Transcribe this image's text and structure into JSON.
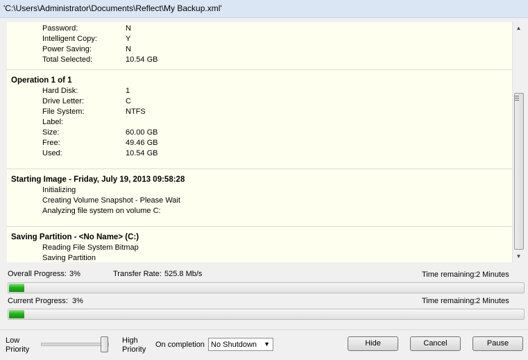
{
  "window": {
    "title": "'C:\\Users\\Administrator\\Documents\\Reflect\\My Backup.xml'"
  },
  "log": {
    "summary_tail": [
      {
        "key": "Password:",
        "value": "N"
      },
      {
        "key": "Intelligent Copy:",
        "value": "Y"
      },
      {
        "key": "Power Saving:",
        "value": "N"
      },
      {
        "key": "Total Selected:",
        "value": "10.54 GB"
      }
    ],
    "operation": {
      "title": "Operation 1 of 1",
      "rows": [
        {
          "key": "Hard Disk:",
          "value": "1"
        },
        {
          "key": "Drive Letter:",
          "value": "C"
        },
        {
          "key": "File System:",
          "value": "NTFS"
        },
        {
          "key": "Label:",
          "value": ""
        },
        {
          "key": "Size:",
          "value": "60.00 GB"
        },
        {
          "key": "Free:",
          "value": "49.46 GB"
        },
        {
          "key": "Used:",
          "value": "10.54 GB"
        }
      ]
    },
    "starting_image": {
      "title": "Starting Image - Friday, July 19, 2013 09:58:28",
      "lines": [
        "Initializing",
        "Creating Volume Snapshot - Please Wait",
        "Analyzing file system on volume C:"
      ]
    },
    "saving_partition": {
      "title": "Saving Partition - <No Name> (C:)",
      "lines": [
        "Reading File System Bitmap",
        "Saving Partition"
      ]
    }
  },
  "scrollbar": {
    "position_fraction": 0.85
  },
  "progress": {
    "overall": {
      "label": "Overall Progress:",
      "value_text": "3%",
      "fraction": 0.03,
      "rate_label": "Transfer Rate:",
      "rate_value": "525.8 Mb/s",
      "time_label": "Time remaining:",
      "time_value": "2 Minutes"
    },
    "current": {
      "label": "Current Progress:",
      "value_text": "3%",
      "fraction": 0.03,
      "time_label": "Time remaining:",
      "time_value": "2 Minutes"
    }
  },
  "controls": {
    "priority": {
      "low_line1": "Low",
      "low_line2": "Priority",
      "high_line1": "High",
      "high_line2": "Priority",
      "level": 1.0
    },
    "on_completion_label": "On completion",
    "on_completion_selected": "No Shutdown",
    "hide_label": "Hide",
    "cancel_label": "Cancel",
    "pause_label": "Pause"
  },
  "colors": {
    "log_background": "#fffff0",
    "progress_fill": "#23b11e",
    "titlebar": "#dbe6f4"
  },
  "icons": {
    "scroll_up": "arrow-up-icon",
    "scroll_down": "arrow-down-icon",
    "select_arrow": "chevron-down-icon"
  }
}
